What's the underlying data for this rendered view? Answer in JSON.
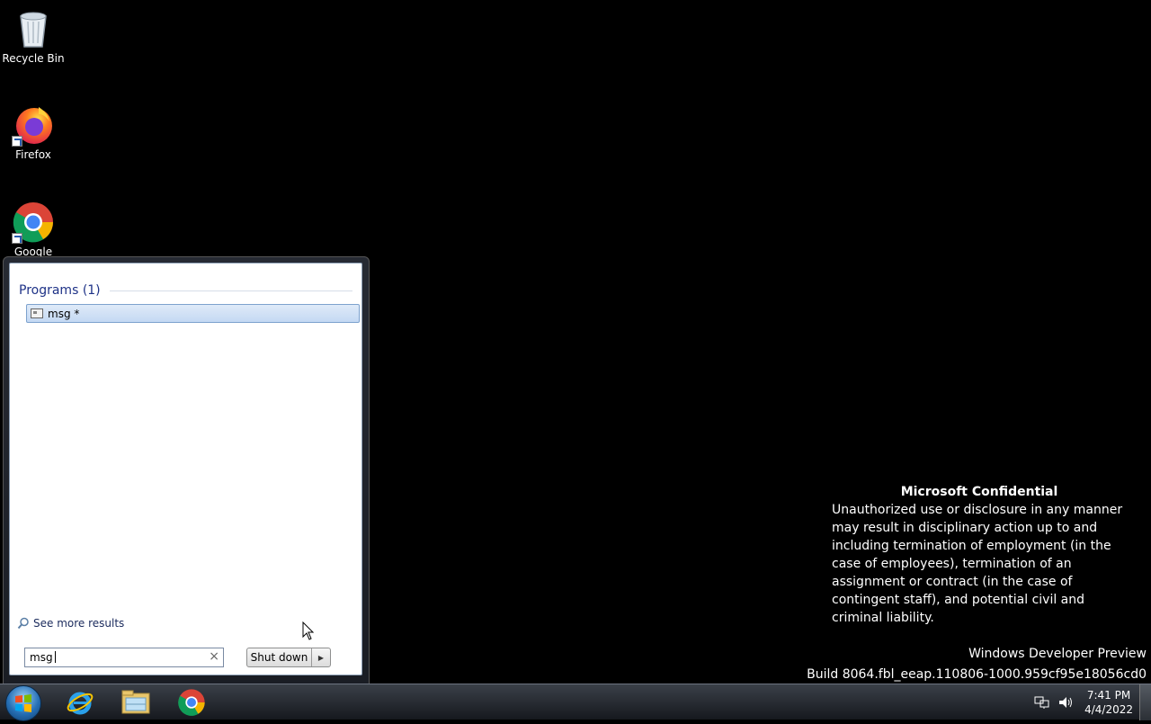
{
  "desktop_icons": [
    {
      "label": "Recycle Bin",
      "icon": "recycle-bin-icon"
    },
    {
      "label": "Firefox",
      "icon": "firefox-icon"
    },
    {
      "label": "Google",
      "icon": "chrome-icon"
    }
  ],
  "start_menu": {
    "results_header": "Programs (1)",
    "results": [
      {
        "label": "msg *",
        "icon": "console-app-icon"
      }
    ],
    "see_more": "See more results",
    "search_value": "msg",
    "shutdown_label": "Shut down"
  },
  "watermark": {
    "title": "Microsoft Confidential",
    "body": "Unauthorized use or disclosure in any manner may result in disciplinary action up to and including termination of employment (in the case of employees), termination of an assignment or contract (in the case of contingent staff), and potential civil and criminal liability.",
    "edition": "Windows Developer Preview",
    "build": "Build 8064.fbl_eeap.110806-1000.959cf95e18056cd0"
  },
  "taskbar": {
    "pinned": [
      "internet-explorer-icon",
      "file-explorer-icon",
      "chrome-icon"
    ],
    "time": "7:41 PM",
    "date": "4/4/2022"
  }
}
